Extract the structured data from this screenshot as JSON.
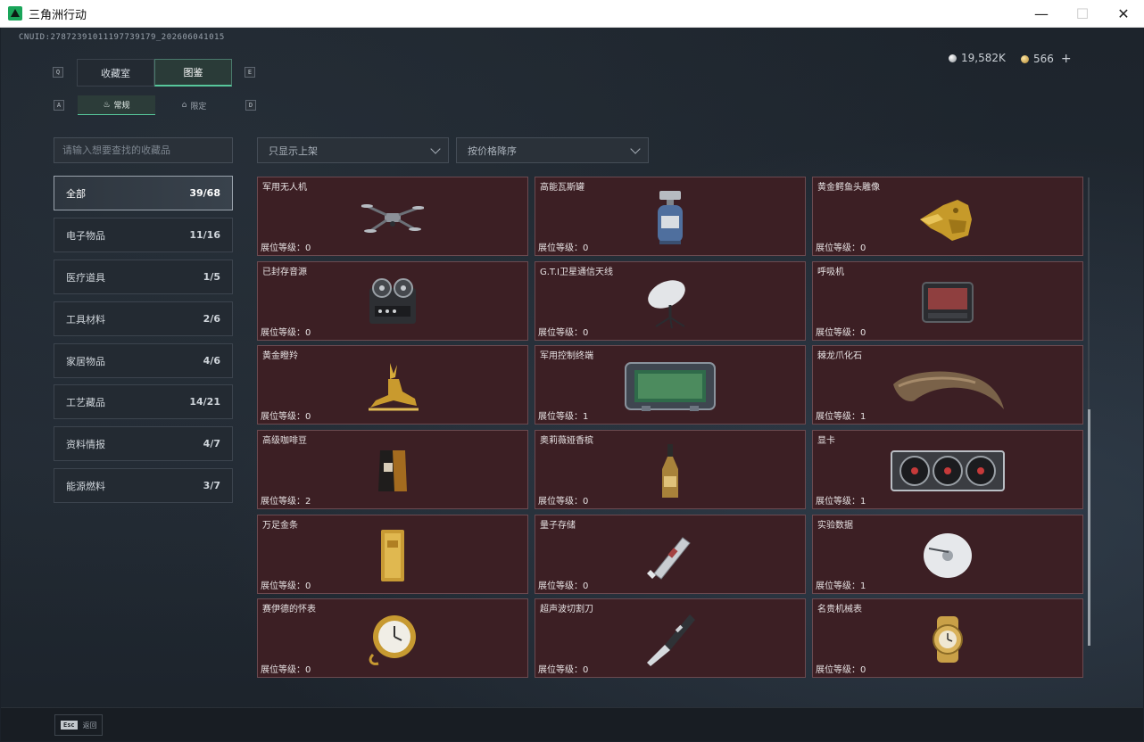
{
  "window": {
    "title": "三角洲行动",
    "buttons": {
      "minimize": "—",
      "maximize": "☐",
      "close": "✕"
    }
  },
  "header": {
    "uid": "CNUID:2787239101119773917​9_202606041015",
    "currency": [
      {
        "icon": "silver-coin-icon",
        "value": "19,582K"
      },
      {
        "icon": "gold-coin-icon",
        "value": "566"
      }
    ],
    "plus": "+"
  },
  "tabs": {
    "prev_key": "Q",
    "next_key": "E",
    "items": [
      {
        "label": "收藏室",
        "active": false
      },
      {
        "label": "图鉴",
        "active": true
      }
    ]
  },
  "subtabs": {
    "prev_key": "A",
    "next_key": "D",
    "items": [
      {
        "label": "常规",
        "icon": "flame-icon",
        "active": true
      },
      {
        "label": "限定",
        "icon": "gift-icon",
        "active": false
      }
    ]
  },
  "search": {
    "placeholder": "请输入想要查找的收藏品"
  },
  "filters": {
    "shelf": "只显示上架",
    "sort": "按价格降序"
  },
  "categories": [
    {
      "label": "全部",
      "count": "39/68",
      "active": true
    },
    {
      "label": "电子物品",
      "count": "11/16"
    },
    {
      "label": "医疗道具",
      "count": "1/5"
    },
    {
      "label": "工具材料",
      "count": "2/6"
    },
    {
      "label": "家居物品",
      "count": "4/6"
    },
    {
      "label": "工艺藏品",
      "count": "14/21"
    },
    {
      "label": "资料情报",
      "count": "4/7"
    },
    {
      "label": "能源燃料",
      "count": "3/7"
    }
  ],
  "items": [
    {
      "name": "军用无人机",
      "level": "展位等级：0",
      "icon": "drone-icon"
    },
    {
      "name": "高能瓦斯罐",
      "level": "展位等级：0",
      "icon": "gas-canister-icon"
    },
    {
      "name": "黄金鳄鱼头雕像",
      "level": "展位等级：0",
      "icon": "gold-crocodile-icon"
    },
    {
      "name": "已封存音源",
      "level": "展位等级：0",
      "icon": "tape-recorder-icon"
    },
    {
      "name": "G.T.I卫星通信天线",
      "level": "展位等级：0",
      "icon": "satellite-dish-icon"
    },
    {
      "name": "呼吸机",
      "level": "展位等级：0",
      "icon": "ventilator-icon"
    },
    {
      "name": "黄金瞪羚",
      "level": "展位等级：0",
      "icon": "gold-gazelle-icon"
    },
    {
      "name": "军用控制终端",
      "level": "展位等级：1",
      "icon": "control-terminal-icon"
    },
    {
      "name": "棘龙爪化石",
      "level": "展位等级：1",
      "icon": "claw-fossil-icon"
    },
    {
      "name": "高级咖啡豆",
      "level": "展位等级：2",
      "icon": "coffee-bag-icon"
    },
    {
      "name": "奥莉薇娅香槟",
      "level": "展位等级：0",
      "icon": "champagne-icon"
    },
    {
      "name": "显卡",
      "level": "展位等级：1",
      "icon": "gpu-icon"
    },
    {
      "name": "万足金条",
      "level": "展位等级：0",
      "icon": "gold-bar-icon"
    },
    {
      "name": "量子存储",
      "level": "展位等级：0",
      "icon": "usb-drive-icon"
    },
    {
      "name": "实验数据",
      "level": "展位等级：1",
      "icon": "disc-icon"
    },
    {
      "name": "赛伊德的怀表",
      "level": "展位等级：0",
      "icon": "pocket-watch-icon"
    },
    {
      "name": "超声波切割刀",
      "level": "展位等级：0",
      "icon": "cutter-knife-icon"
    },
    {
      "name": "名贵机械表",
      "level": "展位等级：0",
      "icon": "wristwatch-icon"
    }
  ],
  "footer": {
    "esc_key": "Esc",
    "back_label": "返回"
  },
  "colors": {
    "card_bg": "#3c1f24",
    "accent_green": "#57c79b"
  }
}
